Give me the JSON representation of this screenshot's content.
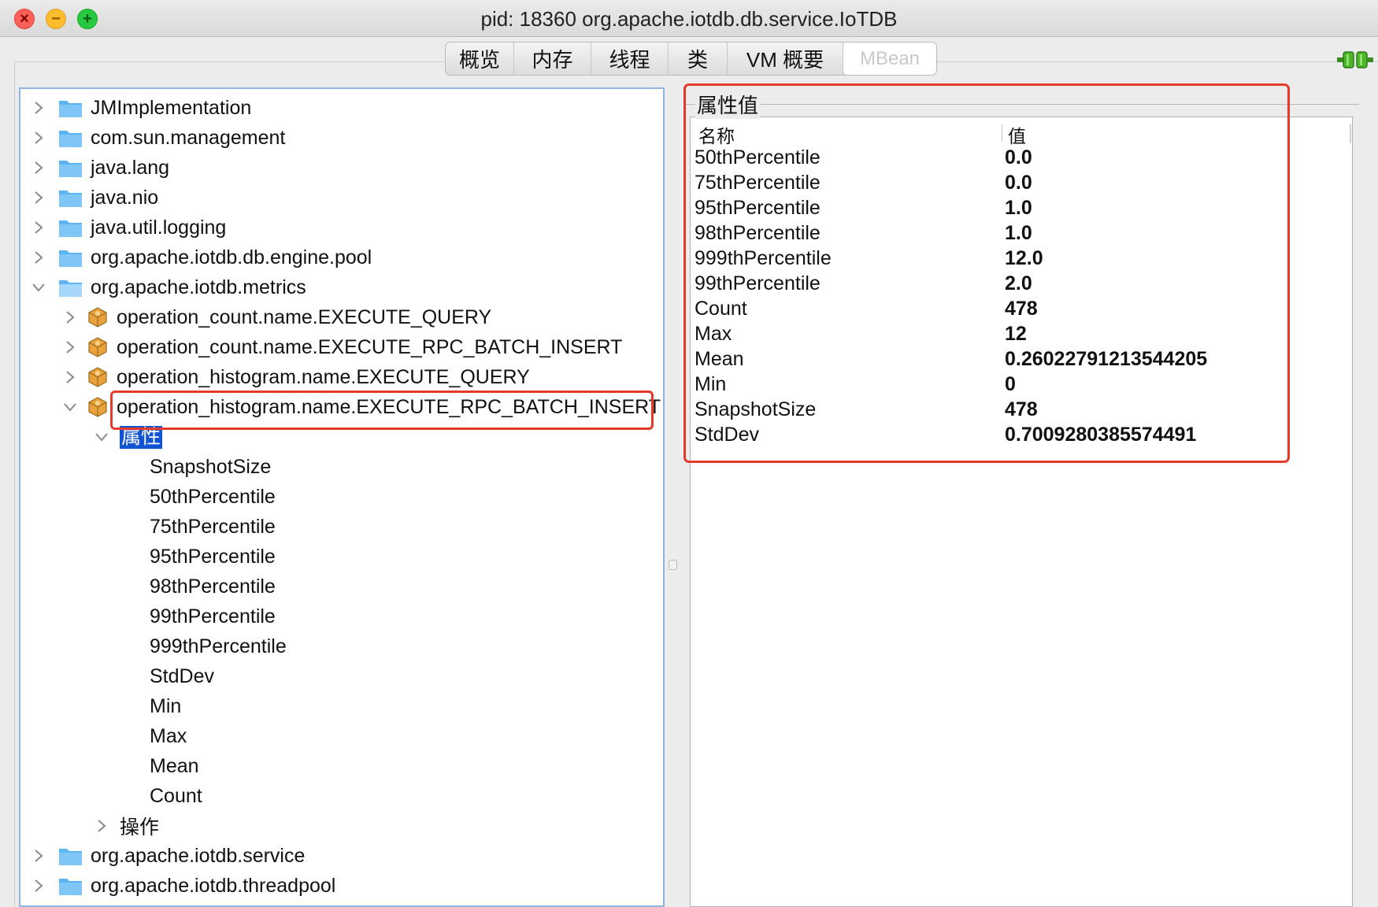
{
  "window": {
    "title": "pid: 18360 org.apache.iotdb.db.service.IoTDB"
  },
  "tabs": [
    {
      "label": "概览"
    },
    {
      "label": "内存"
    },
    {
      "label": "线程"
    },
    {
      "label": "类"
    },
    {
      "label": "VM 概要"
    },
    {
      "label": "MBean"
    }
  ],
  "active_tab": "MBean",
  "tree": {
    "domains": [
      {
        "label": "JMImplementation"
      },
      {
        "label": "com.sun.management"
      },
      {
        "label": "java.lang"
      },
      {
        "label": "java.nio"
      },
      {
        "label": "java.util.logging"
      },
      {
        "label": "org.apache.iotdb.db.engine.pool"
      },
      {
        "label": "org.apache.iotdb.metrics"
      },
      {
        "label": "org.apache.iotdb.service"
      },
      {
        "label": "org.apache.iotdb.threadpool"
      }
    ],
    "mbeans": [
      {
        "label": "operation_count.name.EXECUTE_QUERY"
      },
      {
        "label": "operation_count.name.EXECUTE_RPC_BATCH_INSERT"
      },
      {
        "label": "operation_histogram.name.EXECUTE_QUERY"
      },
      {
        "label": "operation_histogram.name.EXECUTE_RPC_BATCH_INSERT"
      }
    ],
    "attributes_node": "属性",
    "attributes": [
      "SnapshotSize",
      "50thPercentile",
      "75thPercentile",
      "95thPercentile",
      "98thPercentile",
      "99thPercentile",
      "999thPercentile",
      "StdDev",
      "Min",
      "Max",
      "Mean",
      "Count"
    ],
    "operations_node": "操作"
  },
  "attr_panel": {
    "title": "属性值",
    "col_name": "名称",
    "col_value": "值",
    "rows": [
      {
        "name": "50thPercentile",
        "value": "0.0"
      },
      {
        "name": "75thPercentile",
        "value": "0.0"
      },
      {
        "name": "95thPercentile",
        "value": "1.0"
      },
      {
        "name": "98thPercentile",
        "value": "1.0"
      },
      {
        "name": "999thPercentile",
        "value": "12.0"
      },
      {
        "name": "99thPercentile",
        "value": "2.0"
      },
      {
        "name": "Count",
        "value": "478"
      },
      {
        "name": "Max",
        "value": "12"
      },
      {
        "name": "Mean",
        "value": "0.26022791213544205"
      },
      {
        "name": "Min",
        "value": "0"
      },
      {
        "name": "SnapshotSize",
        "value": "478"
      },
      {
        "name": "StdDev",
        "value": "0.7009280385574491"
      }
    ]
  },
  "colors": {
    "highlight": "#e53a2a",
    "selection": "#1155d4",
    "folder": "#5db4f2"
  }
}
